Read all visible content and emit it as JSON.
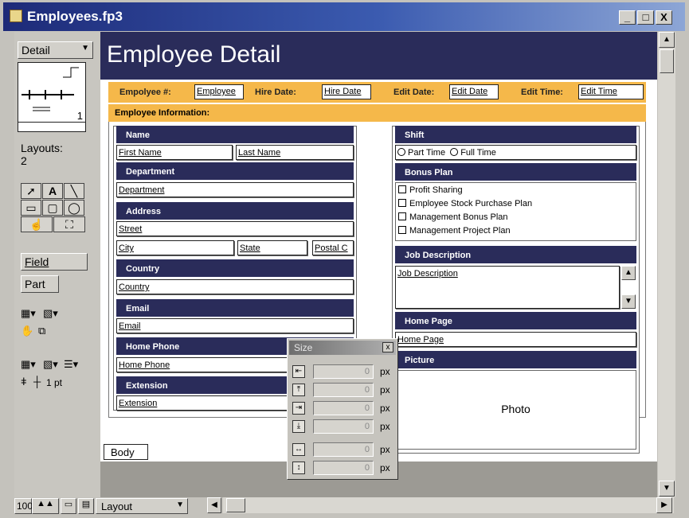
{
  "window": {
    "title": "Employees.fp3",
    "minimize": "_",
    "maximize": "□",
    "close": "X"
  },
  "left_panel": {
    "layout_popup": "Detail",
    "book_page": "1",
    "layouts_label": "Layouts:",
    "layouts_count": "2",
    "tools": [
      "pointer-tool",
      "text-tool",
      "line-tool",
      "rectangle-tool",
      "rounded-rectangle-tool",
      "oval-tool",
      "button-tool",
      "portal-tool"
    ],
    "field_tool": "Field",
    "part_tool": "Part",
    "line_width": "1 pt"
  },
  "canvas": {
    "page_title": "Employee Detail",
    "info_bar": {
      "employee_label": "Empolyee #:",
      "employee_field": "Employee",
      "hire_label": "Hire Date:",
      "hire_field": "Hire Date",
      "edit_date_label": "Edit Date:",
      "edit_date_field": "Edit Date",
      "edit_time_label": "Edit Time:",
      "edit_time_field": "Edit Time"
    },
    "employee_info_label": "Employee Information:",
    "left_column": {
      "name_header": "Name",
      "first_name": "First Name",
      "last_name": "Last Name",
      "department_header": "Department",
      "department": "Department",
      "address_header": "Address",
      "street": "Street",
      "city": "City",
      "state": "State",
      "postal": "Postal C",
      "country_header": "Country",
      "country": "Country",
      "email_header": "Email",
      "email": "Email",
      "home_phone_header": "Home Phone",
      "home_phone": "Home Phone",
      "extension_header": "Extension",
      "extension": "Extension"
    },
    "right_column": {
      "shift_header": "Shift",
      "shift_options": [
        "Part Time",
        "Full Time"
      ],
      "bonus_header": "Bonus Plan",
      "bonus_options": [
        "Profit Sharing",
        "Employee Stock Purchase Plan",
        "Management Bonus Plan",
        "Management Project Plan"
      ],
      "job_desc_header": "Job Description",
      "job_desc": "Job Description",
      "home_page_header": "Home Page",
      "home_page": "Home Page",
      "picture_header": "Picture",
      "photo": "Photo"
    },
    "body_tab": "Body"
  },
  "size_palette": {
    "title": "Size",
    "close": "x",
    "rows": [
      {
        "icon": "left-edge-icon",
        "value": "0",
        "unit": "px"
      },
      {
        "icon": "top-edge-icon",
        "value": "0",
        "unit": "px"
      },
      {
        "icon": "right-edge-icon",
        "value": "0",
        "unit": "px"
      },
      {
        "icon": "bottom-edge-icon",
        "value": "0",
        "unit": "px"
      },
      {
        "icon": "width-icon",
        "value": "0",
        "unit": "px"
      },
      {
        "icon": "height-icon",
        "value": "0",
        "unit": "px"
      }
    ]
  },
  "status_bar": {
    "zoom": "100",
    "mode": "Layout"
  },
  "colors": {
    "header_navy": "#2a2c5a",
    "accent_orange": "#f5b84a"
  }
}
